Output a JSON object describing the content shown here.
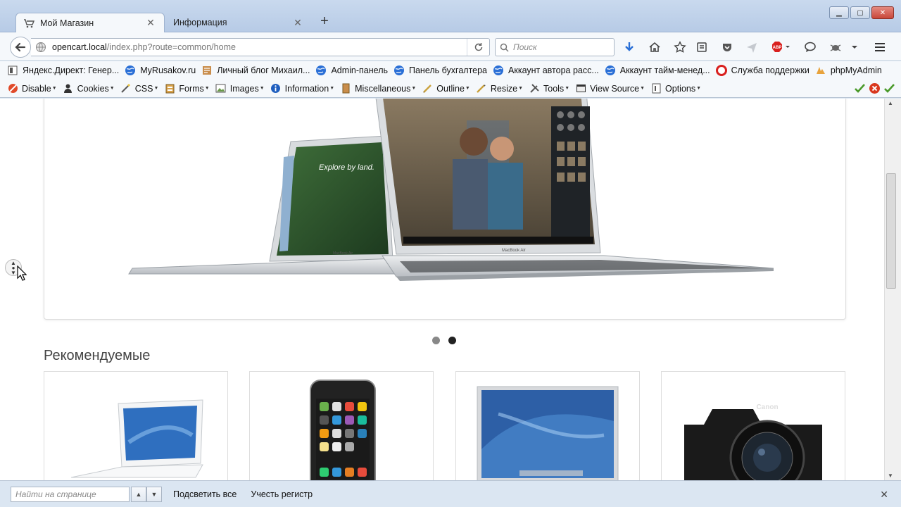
{
  "tabs": [
    {
      "title": "Мой Магазин",
      "icon": "cart-icon",
      "active": true
    },
    {
      "title": "Информация",
      "icon": "none",
      "active": false
    }
  ],
  "newtab_label": "+",
  "nav": {
    "url_host": "opencart.local",
    "url_path": "/index.php?route=common/home",
    "search_placeholder": "Поиск"
  },
  "bookmarks": [
    {
      "label": "Яндекс.Директ: Генер...",
      "icon": "yandex-direct-icon"
    },
    {
      "label": "MyRusakov.ru",
      "icon": "globe-icon"
    },
    {
      "label": "Личный блог Михаил...",
      "icon": "blog-icon"
    },
    {
      "label": "Admin-панель",
      "icon": "globe-icon"
    },
    {
      "label": "Панель бухгалтера",
      "icon": "globe-icon"
    },
    {
      "label": "Аккаунт автора расс...",
      "icon": "globe-icon"
    },
    {
      "label": "Аккаунт тайм-менед...",
      "icon": "globe-icon"
    },
    {
      "label": "Служба поддержки",
      "icon": "support-icon"
    },
    {
      "label": "phpMyAdmin",
      "icon": "phpmyadmin-icon"
    }
  ],
  "devtools": [
    {
      "label": "Disable",
      "icon": "disable-icon"
    },
    {
      "label": "Cookies",
      "icon": "cookies-icon"
    },
    {
      "label": "CSS",
      "icon": "css-icon"
    },
    {
      "label": "Forms",
      "icon": "forms-icon"
    },
    {
      "label": "Images",
      "icon": "images-icon"
    },
    {
      "label": "Information",
      "icon": "information-icon"
    },
    {
      "label": "Miscellaneous",
      "icon": "miscellaneous-icon"
    },
    {
      "label": "Outline",
      "icon": "outline-icon"
    },
    {
      "label": "Resize",
      "icon": "resize-icon"
    },
    {
      "label": "Tools",
      "icon": "tools-icon"
    },
    {
      "label": "View Source",
      "icon": "view-source-icon"
    },
    {
      "label": "Options",
      "icon": "options-icon"
    }
  ],
  "page": {
    "section_title": "Рекомендуемые",
    "slideshow": {
      "dot_count": 2,
      "active_dot": 2
    }
  },
  "findbar": {
    "placeholder": "Найти на странице",
    "highlight_all": "Подсветить все",
    "match_case": "Учесть регистр"
  },
  "colors": {
    "chrome_bg": "#dbe6f2",
    "close_button": "#c9473a",
    "bookmark_blue": "#2a6fd6",
    "page_bg": "#ffffff"
  }
}
